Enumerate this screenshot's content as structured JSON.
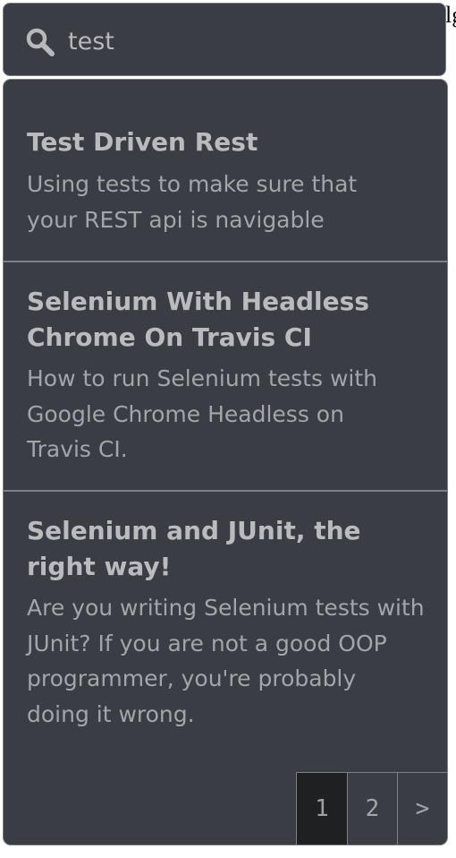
{
  "background_text": "lg",
  "search": {
    "value": "test",
    "icon": "search-icon"
  },
  "results": [
    {
      "title": "Test Driven Rest",
      "description": "Using tests to make sure that your REST api is navigable"
    },
    {
      "title": "Selenium With Headless Chrome On Travis CI",
      "description": "How to run Selenium tests with Google Chrome Headless on Travis CI."
    },
    {
      "title": "Selenium and JUnit, the right way!",
      "description": "Are you writing Selenium tests with JUnit? If you are not a good OOP programmer, you're probably doing it wrong."
    }
  ],
  "pagination": {
    "pages": [
      "1",
      "2"
    ],
    "next_label": ">",
    "current": "1"
  },
  "colors": {
    "panel_bg": "#3a3d43",
    "border": "#7d8187",
    "title_text": "#b9bbbe",
    "desc_text": "#a2a5a9",
    "active_page_bg": "#1f2022"
  }
}
